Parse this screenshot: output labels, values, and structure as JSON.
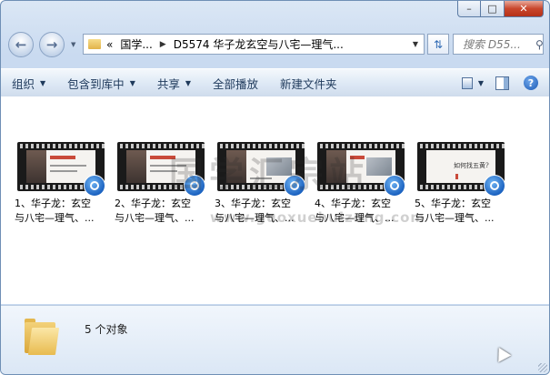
{
  "window": {
    "caption": {
      "minimize": "–",
      "maximize": "□",
      "close": "✕"
    }
  },
  "nav": {
    "back_glyph": "←",
    "forward_glyph": "→",
    "address": {
      "chevrons": "«",
      "crumbs": [
        "国学...",
        "D5574 华子龙玄空与八宅—理气..."
      ]
    },
    "search_placeholder": "搜索 D55...",
    "search_icon": "magnifier-icon",
    "refresh_icon": "refresh-icon"
  },
  "toolbar": {
    "items": [
      {
        "label": "组织",
        "has_menu": true
      },
      {
        "label": "包含到库中",
        "has_menu": true
      },
      {
        "label": "共享",
        "has_menu": true
      },
      {
        "label": "全部播放",
        "has_menu": false
      },
      {
        "label": "新建文件夹",
        "has_menu": false
      }
    ],
    "help_glyph": "?"
  },
  "files": [
    {
      "line1": "1、华子龙：玄空",
      "line2": "与八宅—理气、..."
    },
    {
      "line1": "2、华子龙：玄空",
      "line2": "与八宅—理气、..."
    },
    {
      "line1": "3、华子龙：玄空",
      "line2": "与八宅—理气、..."
    },
    {
      "line1": "4、华子龙：玄空",
      "line2": "与八宅—理气、..."
    },
    {
      "line1": "5、华子龙：玄空",
      "line2": "与八宅—理气、...",
      "slide_text": "如何找五黄?"
    }
  ],
  "watermark": {
    "text": "国学汇宗站",
    "url": "www.guoxuehuizong.com"
  },
  "details": {
    "count": "5 个对象"
  },
  "colors": {
    "chrome": "#c9daf0",
    "toolbar_text": "#1e395b",
    "badge": "#1c63c1"
  }
}
